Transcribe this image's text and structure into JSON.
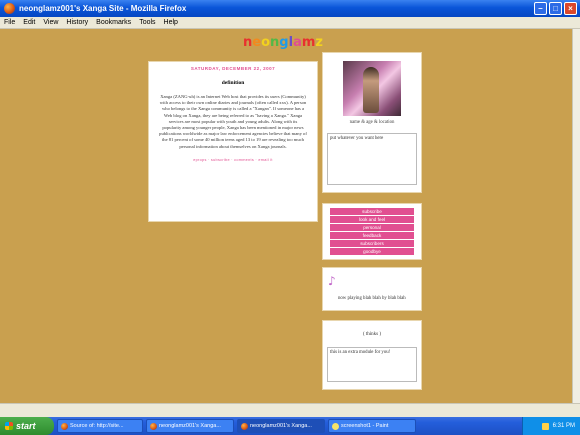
{
  "window": {
    "title": "neonglamz001's Xanga Site - Mozilla Firefox"
  },
  "menu": [
    "File",
    "Edit",
    "View",
    "History",
    "Bookmarks",
    "Tools",
    "Help"
  ],
  "logo": {
    "letters": [
      "n",
      "e",
      "o",
      "n",
      "g",
      "l",
      "a",
      "m",
      "z"
    ],
    "colors": [
      "#e8302e",
      "#f28a1e",
      "#f2d21e",
      "#52b847",
      "#1e9be8",
      "#6a4fc7",
      "#e14f91",
      "#e8302e",
      "#f2d21e"
    ]
  },
  "entry": {
    "date": "SATURDAY, DECEMBER 22, 2007",
    "title": "definition",
    "body": "Xanga (ZANG-uh) is an Internet Web host that provides its users (Community) with access to their own online diaries and journals (often called xxx). A person who belongs to the Xanga community is called a \"Xangan\". If someone has a Web blog on Xanga, they are being referred to as \"having a Xanga.\" Xanga services are most popular with youth and young adults. Along with its popularity among younger people, Xanga has been mentioned in major news publications worldwide as major law enforcement agencies believe that many of the 81 percent of some 40 million teens aged 13 to 19 are revealing too much personal information about themselves on Xanga journals.",
    "links": "eprops · subscribe · comments · email it"
  },
  "profile": {
    "caption": "name & age & location",
    "text": "put whatever you want here"
  },
  "links": [
    "subscribe",
    "look and feel",
    "personal",
    "feedback",
    "subscribers",
    "goodbye"
  ],
  "music": {
    "text": "now playing blah blah by blah blah"
  },
  "thinks": {
    "title": "( thinks )",
    "text": "this is an extra module for you!"
  },
  "taskbar": {
    "start": "start",
    "tasks": [
      "Source of: http://site...",
      "neonglamz001's Xanga...",
      "neonglamz001's Xanga...",
      "screenshot1 - Paint"
    ],
    "time": "6:31 PM"
  },
  "colors": {
    "accent": "#e14f91",
    "page_bg": "#c9a04f"
  }
}
